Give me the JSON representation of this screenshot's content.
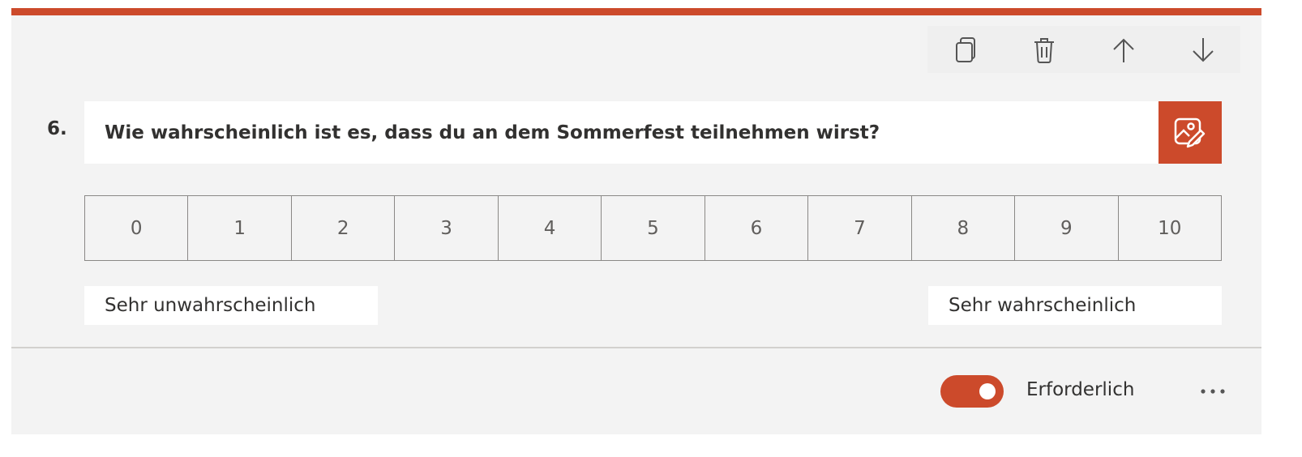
{
  "question": {
    "number": "6.",
    "title": "Wie wahrscheinlich ist es, dass du an dem Sommerfest teilnehmen wirst?",
    "scale": [
      "0",
      "1",
      "2",
      "3",
      "4",
      "5",
      "6",
      "7",
      "8",
      "9",
      "10"
    ],
    "low_label": "Sehr unwahrscheinlich",
    "high_label": "Sehr wahrscheinlich"
  },
  "toolbar": {
    "icons": [
      "copy-icon",
      "trash-icon",
      "arrow-up-icon",
      "arrow-down-icon"
    ]
  },
  "image_button_icon": "image-edit-icon",
  "footer": {
    "required_label": "Erforderlich",
    "required_on": true,
    "more_icon": "more-icon"
  },
  "colors": {
    "accent": "#cc4a2b",
    "card_background": "#f3f3f3",
    "text": "#323130"
  }
}
